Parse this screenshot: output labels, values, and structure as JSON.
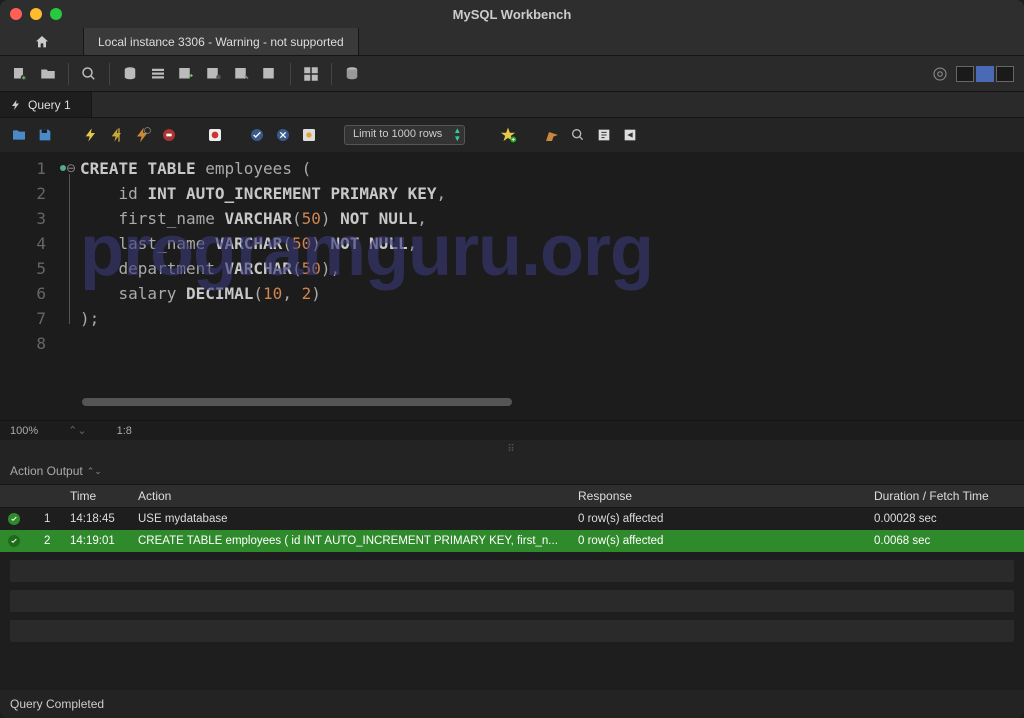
{
  "window": {
    "title": "MySQL Workbench"
  },
  "connection_tab": "Local instance 3306 - Warning - not supported",
  "query_tab": "Query 1",
  "limit_dropdown": "Limit to 1000 rows",
  "editor": {
    "zoom": "100%",
    "cursor": "1:8",
    "lines": [
      "CREATE TABLE employees (",
      "    id INT AUTO_INCREMENT PRIMARY KEY,",
      "    first_name VARCHAR(50) NOT NULL,",
      "    last_name VARCHAR(50) NOT NULL,",
      "    department VARCHAR(50),",
      "    salary DECIMAL(10, 2)",
      ");",
      ""
    ]
  },
  "output": {
    "panel_label": "Action Output",
    "columns": {
      "time": "Time",
      "action": "Action",
      "response": "Response",
      "duration": "Duration / Fetch Time"
    },
    "rows": [
      {
        "idx": "1",
        "time": "14:18:45",
        "action": "USE mydatabase",
        "response": "0 row(s) affected",
        "duration": "0.00028 sec",
        "selected": false
      },
      {
        "idx": "2",
        "time": "14:19:01",
        "action": "CREATE TABLE employees (     id INT AUTO_INCREMENT PRIMARY KEY,     first_n...",
        "response": "0 row(s) affected",
        "duration": "0.0068 sec",
        "selected": true
      }
    ]
  },
  "status_bar": "Query Completed",
  "watermark": "programguru.org"
}
